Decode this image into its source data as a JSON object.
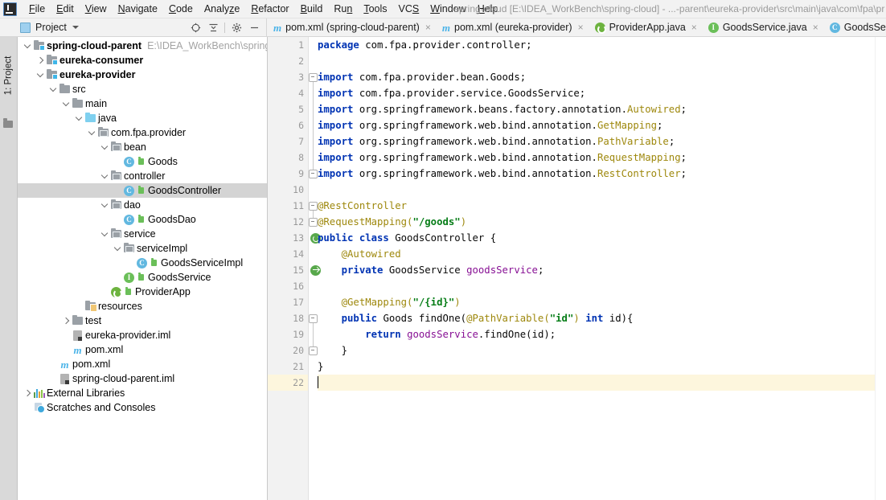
{
  "window": {
    "title": "spring-cloud [E:\\IDEA_WorkBench\\spring-cloud] - ...-parent\\eureka-provider\\src\\main\\java\\com\\fpa\\pr",
    "logo_icon": "intellij-idea-logo"
  },
  "menubar": {
    "items": [
      {
        "label": "File",
        "mnemonic": "F"
      },
      {
        "label": "Edit",
        "mnemonic": "E"
      },
      {
        "label": "View",
        "mnemonic": "V"
      },
      {
        "label": "Navigate",
        "mnemonic": "N"
      },
      {
        "label": "Code",
        "mnemonic": "C"
      },
      {
        "label": "Analyze",
        "mnemonic": "z"
      },
      {
        "label": "Refactor",
        "mnemonic": "R"
      },
      {
        "label": "Build",
        "mnemonic": "B"
      },
      {
        "label": "Run",
        "mnemonic": "n"
      },
      {
        "label": "Tools",
        "mnemonic": "T"
      },
      {
        "label": "VCS",
        "mnemonic": "S"
      },
      {
        "label": "Window",
        "mnemonic": "W"
      },
      {
        "label": "Help",
        "mnemonic": "H"
      }
    ]
  },
  "tool_window": {
    "vertical_tab": "1: Project",
    "panel_title": "Project",
    "panel_icon": "project-view-icon",
    "dropdown_icon": "chevron-down-icon",
    "buttons": [
      {
        "name": "locate-in-tree-icon",
        "title": "Select Opened File"
      },
      {
        "name": "collapse-all-icon",
        "title": "Collapse All"
      },
      {
        "name": "gear-icon",
        "title": "Settings"
      },
      {
        "name": "minimize-icon",
        "title": "Hide"
      }
    ]
  },
  "tree": {
    "nodes": [
      {
        "label": "spring-cloud-parent",
        "path": "E:\\IDEA_WorkBench\\spring-clo",
        "indent": 0,
        "arrow": "down",
        "icon": "module-folder-icon",
        "bold": true,
        "selected": false,
        "source": false
      },
      {
        "label": "eureka-consumer",
        "path": "",
        "indent": 1,
        "arrow": "right",
        "icon": "module-folder-icon",
        "bold": true,
        "selected": false,
        "source": false
      },
      {
        "label": "eureka-provider",
        "path": "",
        "indent": 1,
        "arrow": "down",
        "icon": "module-folder-icon",
        "bold": true,
        "selected": false,
        "source": false
      },
      {
        "label": "src",
        "path": "",
        "indent": 2,
        "arrow": "down",
        "icon": "folder-icon",
        "bold": false,
        "selected": false,
        "source": false
      },
      {
        "label": "main",
        "path": "",
        "indent": 3,
        "arrow": "down",
        "icon": "folder-icon",
        "bold": false,
        "selected": false,
        "source": false
      },
      {
        "label": "java",
        "path": "",
        "indent": 4,
        "arrow": "down",
        "icon": "source-folder-icon",
        "bold": false,
        "selected": false,
        "source": false
      },
      {
        "label": "com.fpa.provider",
        "path": "",
        "indent": 5,
        "arrow": "down",
        "icon": "package-icon",
        "bold": false,
        "selected": false,
        "source": false
      },
      {
        "label": "bean",
        "path": "",
        "indent": 6,
        "arrow": "down",
        "icon": "package-icon",
        "bold": false,
        "selected": false,
        "source": false
      },
      {
        "label": "Goods",
        "path": "",
        "indent": 7,
        "arrow": "none",
        "icon": "java-class-icon",
        "bold": false,
        "selected": false,
        "source": true
      },
      {
        "label": "controller",
        "path": "",
        "indent": 6,
        "arrow": "down",
        "icon": "package-icon",
        "bold": false,
        "selected": false,
        "source": false
      },
      {
        "label": "GoodsController",
        "path": "",
        "indent": 7,
        "arrow": "none",
        "icon": "java-class-icon",
        "bold": false,
        "selected": true,
        "source": true
      },
      {
        "label": "dao",
        "path": "",
        "indent": 6,
        "arrow": "down",
        "icon": "package-icon",
        "bold": false,
        "selected": false,
        "source": false
      },
      {
        "label": "GoodsDao",
        "path": "",
        "indent": 7,
        "arrow": "none",
        "icon": "java-class-icon",
        "bold": false,
        "selected": false,
        "source": true
      },
      {
        "label": "service",
        "path": "",
        "indent": 6,
        "arrow": "down",
        "icon": "package-icon",
        "bold": false,
        "selected": false,
        "source": false
      },
      {
        "label": "serviceImpl",
        "path": "",
        "indent": 7,
        "arrow": "down",
        "icon": "package-icon",
        "bold": false,
        "selected": false,
        "source": false
      },
      {
        "label": "GoodsServiceImpl",
        "path": "",
        "indent": 8,
        "arrow": "none",
        "icon": "java-class-icon",
        "bold": false,
        "selected": false,
        "source": true
      },
      {
        "label": "GoodsService",
        "path": "",
        "indent": 7,
        "arrow": "none",
        "icon": "java-interface-icon",
        "bold": false,
        "selected": false,
        "source": true
      },
      {
        "label": "ProviderApp",
        "path": "",
        "indent": 6,
        "arrow": "none",
        "icon": "spring-boot-class-icon",
        "bold": false,
        "selected": false,
        "source": true
      },
      {
        "label": "resources",
        "path": "",
        "indent": 4,
        "arrow": "none",
        "icon": "resources-folder-icon",
        "bold": false,
        "selected": false,
        "source": false
      },
      {
        "label": "test",
        "path": "",
        "indent": 3,
        "arrow": "right",
        "icon": "folder-icon",
        "bold": false,
        "selected": false,
        "source": false
      },
      {
        "label": "eureka-provider.iml",
        "path": "",
        "indent": 3,
        "arrow": "none",
        "icon": "iml-file-icon",
        "bold": false,
        "selected": false,
        "source": false
      },
      {
        "label": "pom.xml",
        "path": "",
        "indent": 3,
        "arrow": "none",
        "icon": "maven-file-icon",
        "bold": false,
        "selected": false,
        "source": false
      },
      {
        "label": "pom.xml",
        "path": "",
        "indent": 2,
        "arrow": "none",
        "icon": "maven-file-icon",
        "bold": false,
        "selected": false,
        "source": false
      },
      {
        "label": "spring-cloud-parent.iml",
        "path": "",
        "indent": 2,
        "arrow": "none",
        "icon": "iml-file-icon",
        "bold": false,
        "selected": false,
        "source": false
      },
      {
        "label": "External Libraries",
        "path": "",
        "indent": 0,
        "arrow": "right",
        "icon": "external-libraries-icon",
        "bold": false,
        "selected": false,
        "source": false
      },
      {
        "label": "Scratches and Consoles",
        "path": "",
        "indent": 0,
        "arrow": "none",
        "icon": "scratches-icon",
        "bold": false,
        "selected": false,
        "source": false
      }
    ]
  },
  "editor_tabs": [
    {
      "label": "pom.xml (spring-cloud-parent)",
      "icon": "maven-file-icon",
      "active": false,
      "closable": true
    },
    {
      "label": "pom.xml (eureka-provider)",
      "icon": "maven-file-icon",
      "active": false,
      "closable": true
    },
    {
      "label": "ProviderApp.java",
      "icon": "spring-boot-class-icon",
      "active": false,
      "closable": true
    },
    {
      "label": "GoodsService.java",
      "icon": "java-interface-icon",
      "active": false,
      "closable": true
    },
    {
      "label": "GoodsServiceIm",
      "icon": "java-class-icon",
      "active": true,
      "closable": false
    }
  ],
  "editor": {
    "file": "GoodsController.java",
    "caret_line": 22,
    "lines": [
      {
        "n": 1,
        "gutter_icon": "",
        "fold": "",
        "tokens": [
          {
            "t": "package ",
            "c": "kw"
          },
          {
            "t": "com.fpa.provider.controller;",
            "c": "pln"
          }
        ]
      },
      {
        "n": 2,
        "gutter_icon": "",
        "fold": "",
        "tokens": []
      },
      {
        "n": 3,
        "gutter_icon": "",
        "fold": "minus",
        "tokens": [
          {
            "t": "import ",
            "c": "kw"
          },
          {
            "t": "com.fpa.provider.bean.Goods;",
            "c": "pln"
          }
        ]
      },
      {
        "n": 4,
        "gutter_icon": "",
        "fold": "",
        "tokens": [
          {
            "t": "import ",
            "c": "kw"
          },
          {
            "t": "com.fpa.provider.service.GoodsService;",
            "c": "pln"
          }
        ]
      },
      {
        "n": 5,
        "gutter_icon": "",
        "fold": "",
        "tokens": [
          {
            "t": "import ",
            "c": "kw"
          },
          {
            "t": "org.springframework.beans.factory.annotation.",
            "c": "pln"
          },
          {
            "t": "Autowired",
            "c": "ann"
          },
          {
            "t": ";",
            "c": "pln"
          }
        ]
      },
      {
        "n": 6,
        "gutter_icon": "",
        "fold": "",
        "tokens": [
          {
            "t": "import ",
            "c": "kw"
          },
          {
            "t": "org.springframework.web.bind.annotation.",
            "c": "pln"
          },
          {
            "t": "GetMapping",
            "c": "ann"
          },
          {
            "t": ";",
            "c": "pln"
          }
        ]
      },
      {
        "n": 7,
        "gutter_icon": "",
        "fold": "",
        "tokens": [
          {
            "t": "import ",
            "c": "kw"
          },
          {
            "t": "org.springframework.web.bind.annotation.",
            "c": "pln"
          },
          {
            "t": "PathVariable",
            "c": "ann"
          },
          {
            "t": ";",
            "c": "pln"
          }
        ]
      },
      {
        "n": 8,
        "gutter_icon": "",
        "fold": "",
        "tokens": [
          {
            "t": "import ",
            "c": "kw"
          },
          {
            "t": "org.springframework.web.bind.annotation.",
            "c": "pln"
          },
          {
            "t": "RequestMapping",
            "c": "ann"
          },
          {
            "t": ";",
            "c": "pln"
          }
        ]
      },
      {
        "n": 9,
        "gutter_icon": "",
        "fold": "minus",
        "tokens": [
          {
            "t": "import ",
            "c": "kw"
          },
          {
            "t": "org.springframework.web.bind.annotation.",
            "c": "pln"
          },
          {
            "t": "RestController",
            "c": "ann"
          },
          {
            "t": ";",
            "c": "pln"
          }
        ]
      },
      {
        "n": 10,
        "gutter_icon": "",
        "fold": "",
        "tokens": []
      },
      {
        "n": 11,
        "gutter_icon": "",
        "fold": "minus",
        "tokens": [
          {
            "t": "@RestController",
            "c": "ann"
          }
        ]
      },
      {
        "n": 12,
        "gutter_icon": "",
        "fold": "minus",
        "tokens": [
          {
            "t": "@RequestMapping(",
            "c": "ann"
          },
          {
            "t": "\"/goods\"",
            "c": "str"
          },
          {
            "t": ")",
            "c": "ann"
          }
        ]
      },
      {
        "n": 13,
        "gutter_icon": "spring-bean-icon",
        "fold": "",
        "tokens": [
          {
            "t": "public class ",
            "c": "kw"
          },
          {
            "t": "GoodsController {",
            "c": "pln"
          }
        ]
      },
      {
        "n": 14,
        "gutter_icon": "",
        "fold": "",
        "tokens": [
          {
            "t": "    @Autowired",
            "c": "ann"
          }
        ]
      },
      {
        "n": 15,
        "gutter_icon": "spring-autowired-icon",
        "fold": "",
        "tokens": [
          {
            "t": "    private ",
            "c": "kw"
          },
          {
            "t": "GoodsService ",
            "c": "pln"
          },
          {
            "t": "goodsService",
            "c": "fld"
          },
          {
            "t": ";",
            "c": "pln"
          }
        ]
      },
      {
        "n": 16,
        "gutter_icon": "",
        "fold": "",
        "tokens": []
      },
      {
        "n": 17,
        "gutter_icon": "",
        "fold": "",
        "tokens": [
          {
            "t": "    @GetMapping(",
            "c": "ann"
          },
          {
            "t": "\"/{id}\"",
            "c": "str"
          },
          {
            "t": ")",
            "c": "ann"
          }
        ]
      },
      {
        "n": 18,
        "gutter_icon": "",
        "fold": "minus",
        "tokens": [
          {
            "t": "    public ",
            "c": "kw"
          },
          {
            "t": "Goods findOne(",
            "c": "pln"
          },
          {
            "t": "@PathVariable(",
            "c": "ann"
          },
          {
            "t": "\"id\"",
            "c": "str"
          },
          {
            "t": ") ",
            "c": "ann"
          },
          {
            "t": "int ",
            "c": "kw"
          },
          {
            "t": "id){",
            "c": "pln"
          }
        ]
      },
      {
        "n": 19,
        "gutter_icon": "",
        "fold": "",
        "tokens": [
          {
            "t": "        return ",
            "c": "kw"
          },
          {
            "t": "goodsService",
            "c": "fld"
          },
          {
            "t": ".findOne(id);",
            "c": "pln"
          }
        ]
      },
      {
        "n": 20,
        "gutter_icon": "",
        "fold": "minus",
        "tokens": [
          {
            "t": "    }",
            "c": "pln"
          }
        ]
      },
      {
        "n": 21,
        "gutter_icon": "",
        "fold": "",
        "tokens": [
          {
            "t": "}",
            "c": "pln"
          }
        ]
      },
      {
        "n": 22,
        "gutter_icon": "",
        "fold": "",
        "tokens": [],
        "caret": true
      }
    ]
  },
  "colors": {
    "keyword": "#0033b3",
    "annotation": "#9e880d",
    "string": "#067d17",
    "field": "#871094",
    "selection": "#d4d4d4",
    "current_line": "#fdf6dd",
    "chrome": "#f2f2f2"
  }
}
